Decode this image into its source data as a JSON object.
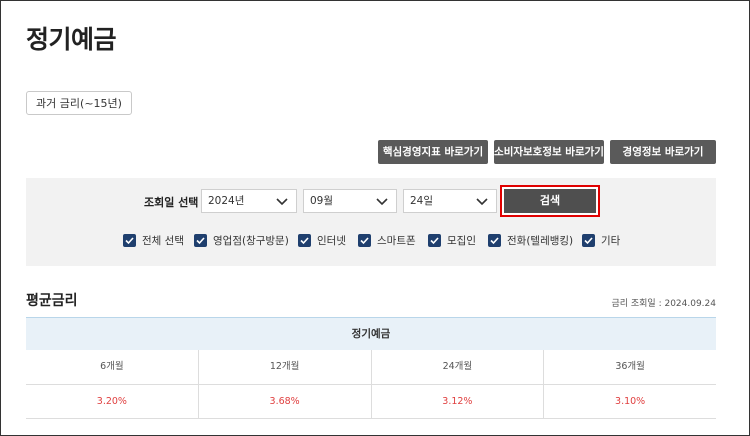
{
  "page": {
    "title": "정기예금"
  },
  "history_button": {
    "label": "과거 금리(~15년)"
  },
  "shortcut_buttons": [
    {
      "label": "핵심경영지표 바로가기"
    },
    {
      "label": "소비자보호정보 바로가기"
    },
    {
      "label": "경영정보 바로가기"
    }
  ],
  "search": {
    "label": "조회일 선택",
    "year": "2024년",
    "month": "09월",
    "day": "24일",
    "button_label": "검색"
  },
  "channels": [
    {
      "label": "전체 선택",
      "checked": true
    },
    {
      "label": "영업점(창구방문)",
      "checked": true
    },
    {
      "label": "인터넷",
      "checked": true
    },
    {
      "label": "스마트폰",
      "checked": true
    },
    {
      "label": "모집인",
      "checked": true
    },
    {
      "label": "전화(텔레뱅킹)",
      "checked": true
    },
    {
      "label": "기타",
      "checked": true
    }
  ],
  "rates": {
    "section_title": "평균금리",
    "query_date": "금리 조회일 : 2024.09.24",
    "table_title": "정기예금",
    "columns": [
      "6개월",
      "12개월",
      "24개월",
      "36개월"
    ],
    "values": [
      "3.20%",
      "3.68%",
      "3.12%",
      "3.10%"
    ]
  },
  "colors": {
    "accent_red": "#e00000",
    "rate_red": "#e04040",
    "checkbox_navy": "#1f3f6e"
  }
}
